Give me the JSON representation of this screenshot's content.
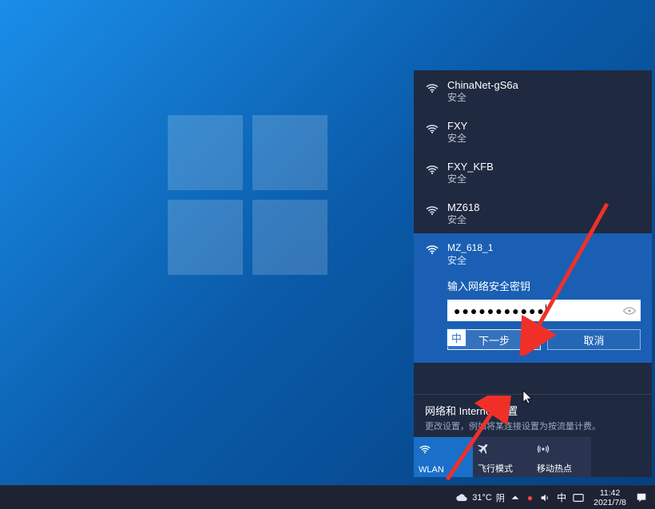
{
  "wifi_list": [
    {
      "name": "ChinaNet-gS6a",
      "security": "安全"
    },
    {
      "name": "FXY",
      "security": "安全"
    },
    {
      "name": "FXY_KFB",
      "security": "安全"
    },
    {
      "name": "MZ618",
      "security": "安全"
    }
  ],
  "selected": {
    "name": "MZ_618_1",
    "security": "安全",
    "prompt": "输入网络安全密钥",
    "password_masked": "●●●●●●●●●●●",
    "ime_indicator": "中",
    "next_button": "下一步",
    "cancel_button": "取消"
  },
  "settings": {
    "title": "网络和 Internet 设置",
    "subtitle": "更改设置，例如将某连接设置为按流量计费。"
  },
  "tiles": {
    "wlan": "WLAN",
    "airplane": "飞行模式",
    "hotspot": "移动热点"
  },
  "taskbar": {
    "weather_temp": "31°C",
    "weather_text": "阴",
    "ime_lang": "中",
    "time": "11:42",
    "date": "2021/7/8",
    "recording": "●"
  }
}
